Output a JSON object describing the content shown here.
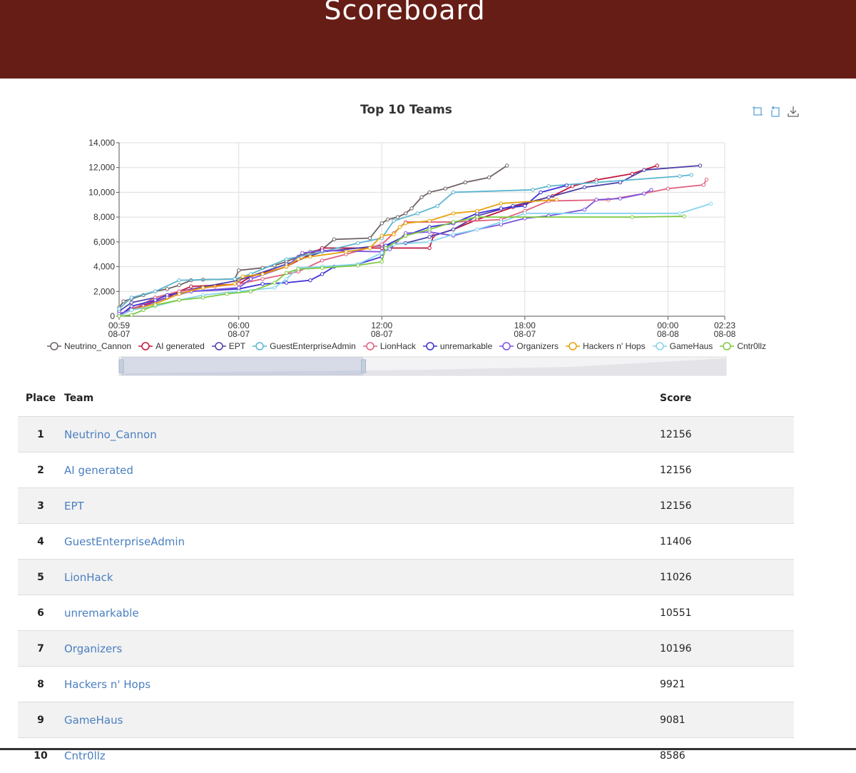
{
  "header": {
    "title": "Scoreboard"
  },
  "toolbox": {
    "icons": [
      "zoom-icon",
      "zoom-reset-icon",
      "download-icon"
    ]
  },
  "table": {
    "headers": {
      "place": "Place",
      "team": "Team",
      "score": "Score"
    },
    "rows": [
      {
        "place": "1",
        "team": "Neutrino_Cannon",
        "score": "12156"
      },
      {
        "place": "2",
        "team": "AI generated",
        "score": "12156"
      },
      {
        "place": "3",
        "team": "EPT",
        "score": "12156"
      },
      {
        "place": "4",
        "team": "GuestEnterpriseAdmin",
        "score": "11406"
      },
      {
        "place": "5",
        "team": "LionHack",
        "score": "11026"
      },
      {
        "place": "6",
        "team": "unremarkable",
        "score": "10551"
      },
      {
        "place": "7",
        "team": "Organizers",
        "score": "10196"
      },
      {
        "place": "8",
        "team": "Hackers n' Hops",
        "score": "9921"
      },
      {
        "place": "9",
        "team": "GameHaus",
        "score": "9081"
      },
      {
        "place": "10",
        "team": "Cntr0llz",
        "score": "8586"
      }
    ]
  },
  "chart_data": {
    "type": "line",
    "title": "Top 10 Teams",
    "ylim": [
      0,
      14000
    ],
    "yticks": [
      "0",
      "2,000",
      "4,000",
      "6,000",
      "8,000",
      "10,000",
      "12,000",
      "14,000"
    ],
    "xticks": [
      [
        "00:59",
        "08-07"
      ],
      [
        "06:00",
        "08-07"
      ],
      [
        "12:00",
        "08-07"
      ],
      [
        "18:00",
        "08-07"
      ],
      [
        "00:00",
        "08-08"
      ],
      [
        "02:23",
        "08-08"
      ]
    ],
    "xlim": [
      "08-07 00:59",
      "08-08 02:23"
    ],
    "grid": true,
    "legend_position": "bottom",
    "datazoom": {
      "start_percent": 0,
      "end_percent": 40
    },
    "series": [
      {
        "name": "Neutrino_Cannon",
        "color": "#6f6262",
        "points": [
          [
            "08-07 00:59",
            700
          ],
          [
            "08-07 01:10",
            1200
          ],
          [
            "08-07 01:30",
            1400
          ],
          [
            "08-07 02:00",
            1700
          ],
          [
            "08-07 02:30",
            2000
          ],
          [
            "08-07 03:00",
            2200
          ],
          [
            "08-07 03:30",
            2500
          ],
          [
            "08-07 04:00",
            2900
          ],
          [
            "08-07 04:30",
            2950
          ],
          [
            "08-07 05:50",
            3000
          ],
          [
            "08-07 06:00",
            3700
          ],
          [
            "08-07 07:00",
            3900
          ],
          [
            "08-07 07:30",
            4100
          ],
          [
            "08-07 08:00",
            4400
          ],
          [
            "08-07 08:30",
            4800
          ],
          [
            "08-07 09:00",
            5200
          ],
          [
            "08-07 09:30",
            5400
          ],
          [
            "08-07 10:00",
            6200
          ],
          [
            "08-07 11:30",
            6300
          ],
          [
            "08-07 12:00",
            7500
          ],
          [
            "08-07 12:15",
            7800
          ],
          [
            "08-07 12:40",
            8000
          ],
          [
            "08-07 13:00",
            8300
          ],
          [
            "08-07 13:15",
            8700
          ],
          [
            "08-07 13:40",
            9600
          ],
          [
            "08-07 14:00",
            10000
          ],
          [
            "08-07 14:40",
            10300
          ],
          [
            "08-07 15:30",
            10800
          ],
          [
            "08-07 16:30",
            11200
          ],
          [
            "08-07 17:15",
            12156
          ]
        ]
      },
      {
        "name": "AI generated",
        "color": "#c0163c",
        "points": [
          [
            "08-07 00:59",
            0
          ],
          [
            "08-07 01:30",
            600
          ],
          [
            "08-07 02:30",
            1200
          ],
          [
            "08-07 03:00",
            1500
          ],
          [
            "08-07 03:30",
            2000
          ],
          [
            "08-07 04:00",
            2400
          ],
          [
            "08-07 06:00",
            2600
          ],
          [
            "08-07 06:30",
            3200
          ],
          [
            "08-07 08:00",
            4000
          ],
          [
            "08-07 09:30",
            5500
          ],
          [
            "08-07 12:00",
            5500
          ],
          [
            "08-07 14:00",
            5500
          ],
          [
            "08-07 14:10",
            6500
          ],
          [
            "08-07 15:00",
            7000
          ],
          [
            "08-07 16:00",
            7800
          ],
          [
            "08-07 17:30",
            8800
          ],
          [
            "08-07 19:10",
            9700
          ],
          [
            "08-07 20:00",
            10500
          ],
          [
            "08-07 21:00",
            11000
          ],
          [
            "08-07 22:30",
            11500
          ],
          [
            "08-07 23:33",
            12156
          ]
        ]
      },
      {
        "name": "EPT",
        "color": "#4b3fa8",
        "points": [
          [
            "08-07 00:59",
            400
          ],
          [
            "08-07 01:30",
            1100
          ],
          [
            "08-07 02:30",
            1500
          ],
          [
            "08-07 03:30",
            2000
          ],
          [
            "08-07 06:00",
            2900
          ],
          [
            "08-07 08:00",
            4200
          ],
          [
            "08-07 09:30",
            5200
          ],
          [
            "08-07 12:00",
            5700
          ],
          [
            "08-07 13:00",
            5900
          ],
          [
            "08-07 14:00",
            6400
          ],
          [
            "08-07 15:00",
            7000
          ],
          [
            "08-07 16:00",
            8100
          ],
          [
            "08-07 17:30",
            8900
          ],
          [
            "08-07 19:00",
            9600
          ],
          [
            "08-07 20:30",
            10400
          ],
          [
            "08-07 22:00",
            10800
          ],
          [
            "08-07 23:00",
            11800
          ],
          [
            "08-08 01:21",
            12156
          ]
        ]
      },
      {
        "name": "GuestEnterpriseAdmin",
        "color": "#5bb5d0",
        "points": [
          [
            "08-07 00:59",
            600
          ],
          [
            "08-07 01:30",
            1500
          ],
          [
            "08-07 02:30",
            2000
          ],
          [
            "08-07 03:30",
            2900
          ],
          [
            "08-07 05:50",
            3000
          ],
          [
            "08-07 06:30",
            3400
          ],
          [
            "08-07 08:00",
            4600
          ],
          [
            "08-07 09:30",
            5200
          ],
          [
            "08-07 11:00",
            5900
          ],
          [
            "08-07 12:00",
            6300
          ],
          [
            "08-07 12:30",
            7700
          ],
          [
            "08-07 13:30",
            8300
          ],
          [
            "08-07 14:20",
            8900
          ],
          [
            "08-07 15:00",
            10000
          ],
          [
            "08-07 18:20",
            10200
          ],
          [
            "08-07 19:00",
            10500
          ],
          [
            "08-07 21:00",
            10800
          ],
          [
            "08-08 00:30",
            11300
          ],
          [
            "08-08 00:59",
            11406
          ]
        ]
      },
      {
        "name": "LionHack",
        "color": "#e0607e",
        "points": [
          [
            "08-07 00:59",
            0
          ],
          [
            "08-07 01:30",
            500
          ],
          [
            "08-07 02:30",
            1500
          ],
          [
            "08-07 03:30",
            2000
          ],
          [
            "08-07 05:00",
            2400
          ],
          [
            "08-07 06:00",
            2600
          ],
          [
            "08-07 07:00",
            3000
          ],
          [
            "08-07 08:30",
            3600
          ],
          [
            "08-07 09:30",
            4500
          ],
          [
            "08-07 10:30",
            5000
          ],
          [
            "08-07 12:00",
            5800
          ],
          [
            "08-07 12:30",
            6700
          ],
          [
            "08-07 13:00",
            7600
          ],
          [
            "08-07 15:00",
            7600
          ],
          [
            "08-07 17:00",
            7800
          ],
          [
            "08-07 18:00",
            8500
          ],
          [
            "08-07 19:00",
            9300
          ],
          [
            "08-07 21:30",
            9400
          ],
          [
            "08-07 23:00",
            9900
          ],
          [
            "08-08 00:00",
            10300
          ],
          [
            "08-08 01:30",
            10600
          ],
          [
            "08-08 01:37",
            11026
          ]
        ]
      },
      {
        "name": "unremarkable",
        "color": "#3d2fd6",
        "points": [
          [
            "08-07 00:59",
            0
          ],
          [
            "08-07 01:30",
            800
          ],
          [
            "08-07 02:30",
            1300
          ],
          [
            "08-07 03:00",
            1700
          ],
          [
            "08-07 04:00",
            2000
          ],
          [
            "08-07 06:00",
            2200
          ],
          [
            "08-07 07:00",
            2600
          ],
          [
            "08-07 08:00",
            2700
          ],
          [
            "08-07 09:00",
            2900
          ],
          [
            "08-07 09:30",
            3400
          ],
          [
            "08-07 10:00",
            4000
          ],
          [
            "08-07 11:00",
            4200
          ],
          [
            "08-07 12:00",
            4800
          ],
          [
            "08-07 12:10",
            5700
          ],
          [
            "08-07 13:00",
            6500
          ],
          [
            "08-07 14:00",
            7200
          ],
          [
            "08-07 15:00",
            7500
          ],
          [
            "08-07 16:00",
            8300
          ],
          [
            "08-07 17:00",
            8700
          ],
          [
            "08-07 18:00",
            8900
          ],
          [
            "08-07 18:40",
            10000
          ],
          [
            "08-07 19:45",
            10551
          ]
        ]
      },
      {
        "name": "Organizers",
        "color": "#7b52e0",
        "points": [
          [
            "08-07 00:59",
            200
          ],
          [
            "08-07 02:00",
            800
          ],
          [
            "08-07 03:00",
            1500
          ],
          [
            "08-07 04:00",
            2000
          ],
          [
            "08-07 06:00",
            2300
          ],
          [
            "08-07 06:30",
            3000
          ],
          [
            "08-07 08:00",
            4000
          ],
          [
            "08-07 08:40",
            5100
          ],
          [
            "08-07 09:30",
            5300
          ],
          [
            "08-07 12:00",
            5200
          ],
          [
            "08-07 12:20",
            5400
          ],
          [
            "08-07 13:00",
            6700
          ],
          [
            "08-07 14:00",
            6800
          ],
          [
            "08-07 15:00",
            6500
          ],
          [
            "08-07 16:00",
            7000
          ],
          [
            "08-07 17:00",
            7400
          ],
          [
            "08-07 18:00",
            7900
          ],
          [
            "08-07 19:00",
            8100
          ],
          [
            "08-07 20:30",
            8600
          ],
          [
            "08-07 21:00",
            9400
          ],
          [
            "08-07 22:00",
            9500
          ],
          [
            "08-07 23:00",
            9900
          ],
          [
            "08-07 23:18",
            10196
          ]
        ]
      },
      {
        "name": "Hackers n' Hops",
        "color": "#e8a20c",
        "points": [
          [
            "08-07 00:59",
            0
          ],
          [
            "08-07 01:30",
            500
          ],
          [
            "08-07 02:30",
            1000
          ],
          [
            "08-07 03:30",
            1800
          ],
          [
            "08-07 04:30",
            2300
          ],
          [
            "08-07 05:50",
            2600
          ],
          [
            "08-07 06:10",
            3200
          ],
          [
            "08-07 07:00",
            3400
          ],
          [
            "08-07 08:00",
            4000
          ],
          [
            "08-07 08:30",
            4600
          ],
          [
            "08-07 09:00",
            4800
          ],
          [
            "08-07 10:30",
            5200
          ],
          [
            "08-07 11:30",
            5500
          ],
          [
            "08-07 12:00",
            6500
          ],
          [
            "08-07 12:30",
            6600
          ],
          [
            "08-07 12:45",
            7200
          ],
          [
            "08-07 13:00",
            7500
          ],
          [
            "08-07 14:00",
            7700
          ],
          [
            "08-07 15:00",
            8300
          ],
          [
            "08-07 16:00",
            8500
          ],
          [
            "08-07 17:00",
            9100
          ],
          [
            "08-07 19:20",
            9400
          ]
        ]
      },
      {
        "name": "GameHaus",
        "color": "#86d4ee",
        "points": [
          [
            "08-07 00:59",
            0
          ],
          [
            "08-07 01:30",
            500
          ],
          [
            "08-07 02:30",
            800
          ],
          [
            "08-07 03:30",
            1300
          ],
          [
            "08-07 04:30",
            1700
          ],
          [
            "08-07 06:00",
            2000
          ],
          [
            "08-07 07:30",
            2300
          ],
          [
            "08-07 08:00",
            3000
          ],
          [
            "08-07 08:30",
            3900
          ],
          [
            "08-07 09:30",
            4000
          ],
          [
            "08-07 11:00",
            4200
          ],
          [
            "08-07 12:00",
            5100
          ],
          [
            "08-07 12:30",
            5800
          ],
          [
            "08-07 14:00",
            6000
          ],
          [
            "08-07 15:00",
            6600
          ],
          [
            "08-07 16:00",
            7000
          ],
          [
            "08-07 17:00",
            7600
          ],
          [
            "08-07 18:00",
            8300
          ],
          [
            "08-08 00:30",
            8300
          ],
          [
            "08-08 01:48",
            9081
          ]
        ]
      },
      {
        "name": "Cntr0llz",
        "color": "#7cc940",
        "points": [
          [
            "08-07 00:59",
            0
          ],
          [
            "08-07 01:30",
            100
          ],
          [
            "08-07 02:00",
            500
          ],
          [
            "08-07 02:30",
            900
          ],
          [
            "08-07 03:30",
            1300
          ],
          [
            "08-07 04:30",
            1500
          ],
          [
            "08-07 05:30",
            1800
          ],
          [
            "08-07 06:30",
            2000
          ],
          [
            "08-07 07:30",
            2700
          ],
          [
            "08-07 08:00",
            3500
          ],
          [
            "08-07 08:30",
            3800
          ],
          [
            "08-07 09:30",
            3900
          ],
          [
            "08-07 11:00",
            4100
          ],
          [
            "08-07 12:00",
            4400
          ],
          [
            "08-07 12:10",
            5500
          ],
          [
            "08-07 13:00",
            6500
          ],
          [
            "08-07 14:00",
            7000
          ],
          [
            "08-07 15:00",
            7600
          ],
          [
            "08-07 16:00",
            8000
          ],
          [
            "08-07 22:30",
            8000
          ],
          [
            "08-08 00:41",
            8065
          ]
        ]
      }
    ]
  }
}
